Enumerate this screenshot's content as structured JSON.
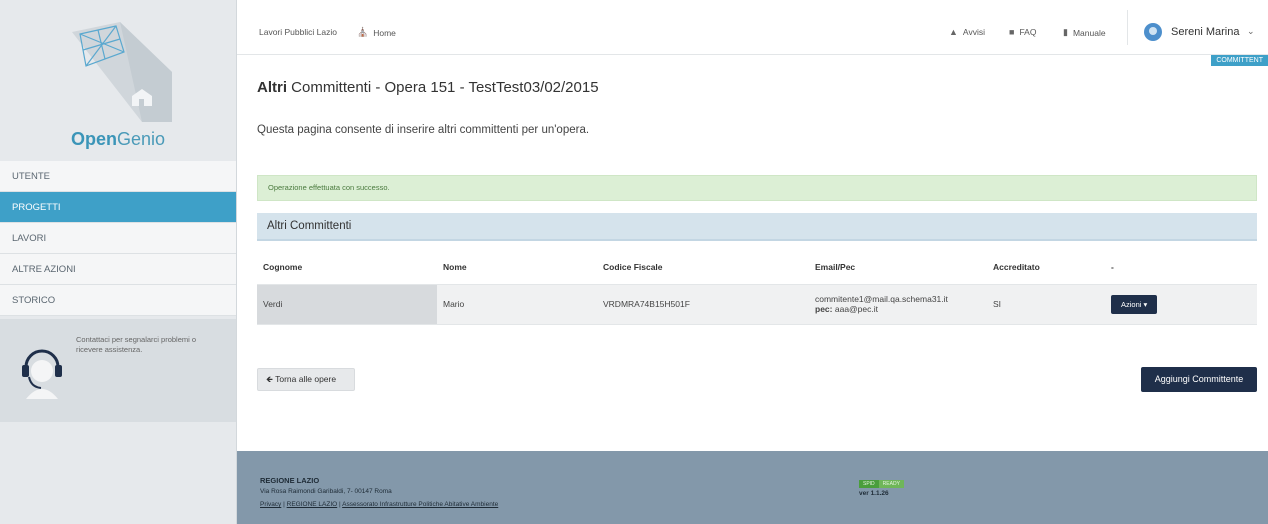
{
  "app": {
    "logo_strong": "Open",
    "logo_light": "Genio",
    "brand_color": "#3ea0c8"
  },
  "sidebar": {
    "items": [
      {
        "label": "UTENTE",
        "active": false
      },
      {
        "label": "PROGETTI",
        "active": true
      },
      {
        "label": "LAVORI",
        "active": false
      },
      {
        "label": "ALTRE AZIONI",
        "active": false
      },
      {
        "label": "STORICO",
        "active": false
      }
    ],
    "support_text": "Contattaci per segnalarci problemi o ricevere assistenza."
  },
  "topbar": {
    "site_label": "Lavori Pubblici Lazio",
    "home_label": "Home",
    "avvisi_label": "Avvisi",
    "faq_label": "FAQ",
    "manuale_label": "Manuale",
    "user_name": "Sereni Marina",
    "role_badge": "COMMITTENT"
  },
  "page": {
    "title_strong": "Altri",
    "title_rest": " Committenti - Opera 151 - TestTest03/02/2015",
    "description": "Questa pagina consente di inserire altri committenti per un'opera.",
    "alert": "Operazione effettuata con successo.",
    "panel_title": "Altri Committenti"
  },
  "table": {
    "headers": [
      "Cognome",
      "Nome",
      "Codice Fiscale",
      "Email/Pec",
      "Accreditato",
      "-"
    ],
    "rows": [
      {
        "cognome": "Verdi",
        "nome": "Mario",
        "codice_fiscale": "VRDMRA74B15H501F",
        "email": "commitente1@mail.qa.schema31.it",
        "pec_label": "pec:",
        "pec": "aaa@pec.it",
        "accreditato": "SI",
        "action_label": "Azioni"
      }
    ]
  },
  "buttons": {
    "back_label": "Torna alle opere",
    "add_label": "Aggiungi Committente"
  },
  "footer": {
    "title": "REGIONE LAZIO",
    "address": "Via Rosa Raimondi Garibaldi, 7- 00147 Roma",
    "link_privacy": "Privacy",
    "link_regione": "REGIONE LAZIO",
    "link_assessorato": "Assessorato Infrastrutture Politiche Abitative Ambiente",
    "badge_left": "SPID",
    "badge_right": "READY",
    "version": "ver 1.1.26"
  }
}
